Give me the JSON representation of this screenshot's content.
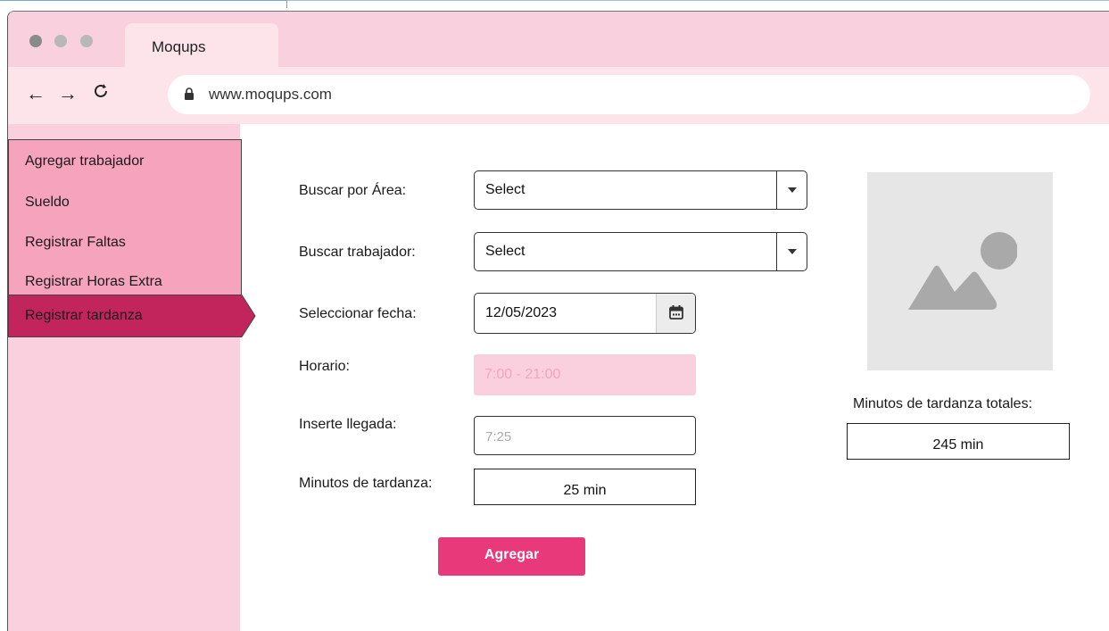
{
  "browser": {
    "tab_title": "Moqups",
    "url": "www.moqups.com",
    "icons": [
      "back-arrow-icon",
      "forward-arrow-icon",
      "reload-icon",
      "lock-icon"
    ]
  },
  "sidebar": {
    "items": [
      {
        "label": "Agregar trabajador"
      },
      {
        "label": "Sueldo"
      },
      {
        "label": "Registrar Faltas"
      },
      {
        "label": "Registrar Horas Extra"
      },
      {
        "label": "Registrar tardanza",
        "active": true
      }
    ]
  },
  "form": {
    "area_label": "Buscar por Área:",
    "area_value": "Select",
    "worker_label": "Buscar trabajador:",
    "worker_value": "Select",
    "date_label": "Seleccionar fecha:",
    "date_value": "12/05/2023",
    "schedule_label": "Horario:",
    "schedule_value": "7:00 - 21:00",
    "arrival_label": "Inserte llegada:",
    "arrival_placeholder": "7:25",
    "late_label": "Minutos de tardanza:",
    "late_value": "25 min",
    "submit_label": "Agregar"
  },
  "summary": {
    "total_label": "Minutos de tardanza totales:",
    "total_value": "245 min"
  },
  "colors": {
    "accent": "#e8397b",
    "sidebar_bg": "#fbd0de",
    "menu_bg": "#f6a3bd",
    "active_menu": "#c2255c",
    "titlebar": "#f9d0dd"
  }
}
